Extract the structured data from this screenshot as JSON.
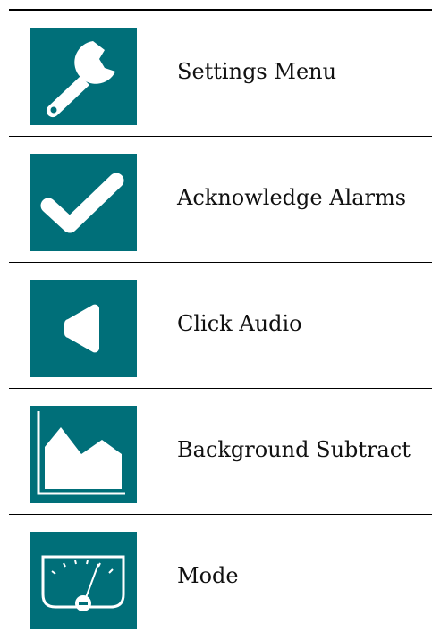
{
  "rows": [
    {
      "label": "Settings Menu",
      "icon": "wrench-icon"
    },
    {
      "label": "Acknowledge Alarms",
      "icon": "checkmark-icon"
    },
    {
      "label": "Click Audio",
      "icon": "speaker-icon"
    },
    {
      "label": "Background Subtract",
      "icon": "area-chart-icon"
    },
    {
      "label": "Mode",
      "icon": "gauge-meter-icon"
    }
  ],
  "colors": {
    "tile": "#006f79",
    "icon": "#ffffff",
    "rule": "#000000"
  }
}
